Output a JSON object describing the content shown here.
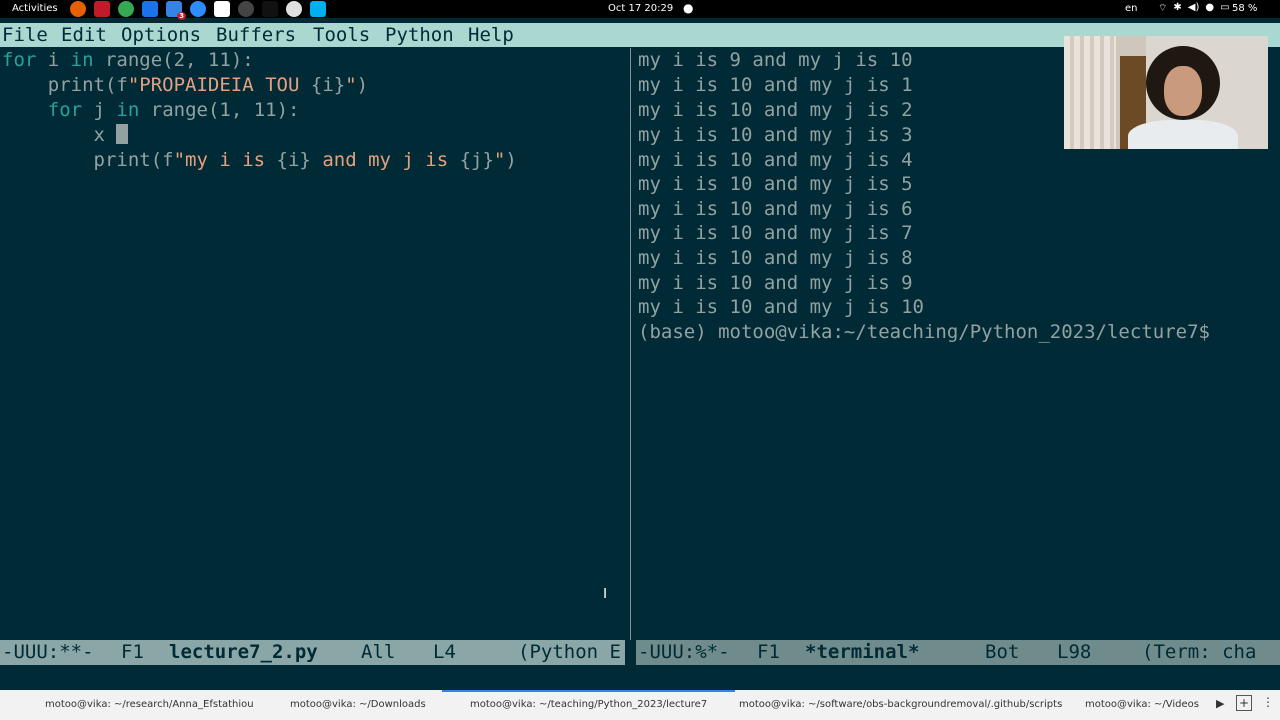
{
  "topbar": {
    "activities": "Activities",
    "clock": "Oct 17  20:29",
    "dot": "●",
    "lang": "en",
    "battery": "58 %",
    "dock_badge": "3"
  },
  "menubar": {
    "items": [
      "File",
      "Edit",
      "Options",
      "Buffers",
      "Tools",
      "Python",
      "Help"
    ]
  },
  "editor": {
    "lines": [
      {
        "kw1": "for",
        "t1": " i ",
        "kw2": "in",
        "t2": " range(2, 11):"
      },
      {
        "t1": "    print(f",
        "s1": "\"PROPAIDEIA TOU ",
        "t2": "{i}",
        "s2": "\"",
        "t3": ")"
      },
      {
        "t0": "    ",
        "kw1": "for",
        "t1": " j ",
        "kw2": "in",
        "t2": " range(1, 11):"
      },
      {
        "t1": "        x "
      },
      {
        "t1": "        print(f",
        "s1": "\"my i is ",
        "t2": "{i}",
        "s2": " and my j is ",
        "t3": "{j}",
        "s3": "\"",
        "t4": ")"
      }
    ]
  },
  "terminal": {
    "lines": [
      "my i is 9 and my j is 10",
      "my i is 10 and my j is 1",
      "my i is 10 and my j is 2",
      "my i is 10 and my j is 3",
      "my i is 10 and my j is 4",
      "my i is 10 and my j is 5",
      "my i is 10 and my j is 6",
      "my i is 10 and my j is 7",
      "my i is 10 and my j is 8",
      "my i is 10 and my j is 9",
      "my i is 10 and my j is 10",
      "(base) motoo@vika:~/teaching/Python_2023/lecture7$"
    ]
  },
  "modeline_left": {
    "status": "-UUU:**-",
    "frame": "F1",
    "buffer": "lecture7_2.py",
    "position": "All",
    "line": "L4",
    "mode": "(Python E"
  },
  "modeline_right": {
    "status": "-UUU:%*-",
    "frame": "F1",
    "buffer": "*terminal*",
    "position": "Bot",
    "line": "L98",
    "mode": "(Term: cha"
  },
  "taskbar": {
    "tasks": [
      "motoo@vika: ~/research/Anna_Efstathiou",
      "motoo@vika: ~/Downloads",
      "motoo@vika: ~/teaching/Python_2023/lecture7",
      "motoo@vika: ~/software/obs-backgroundremoval/.github/scripts",
      "motoo@vika: ~/Videos"
    ],
    "active_index": 2
  },
  "colors": {
    "background": "#002b36",
    "menubar": "#a9d8d1",
    "keyword": "#2aa198",
    "string": "#e4a17f",
    "text": "#93a1a1",
    "modeline_active": "#8aa6a6",
    "modeline_inactive": "#6f8b8b"
  }
}
